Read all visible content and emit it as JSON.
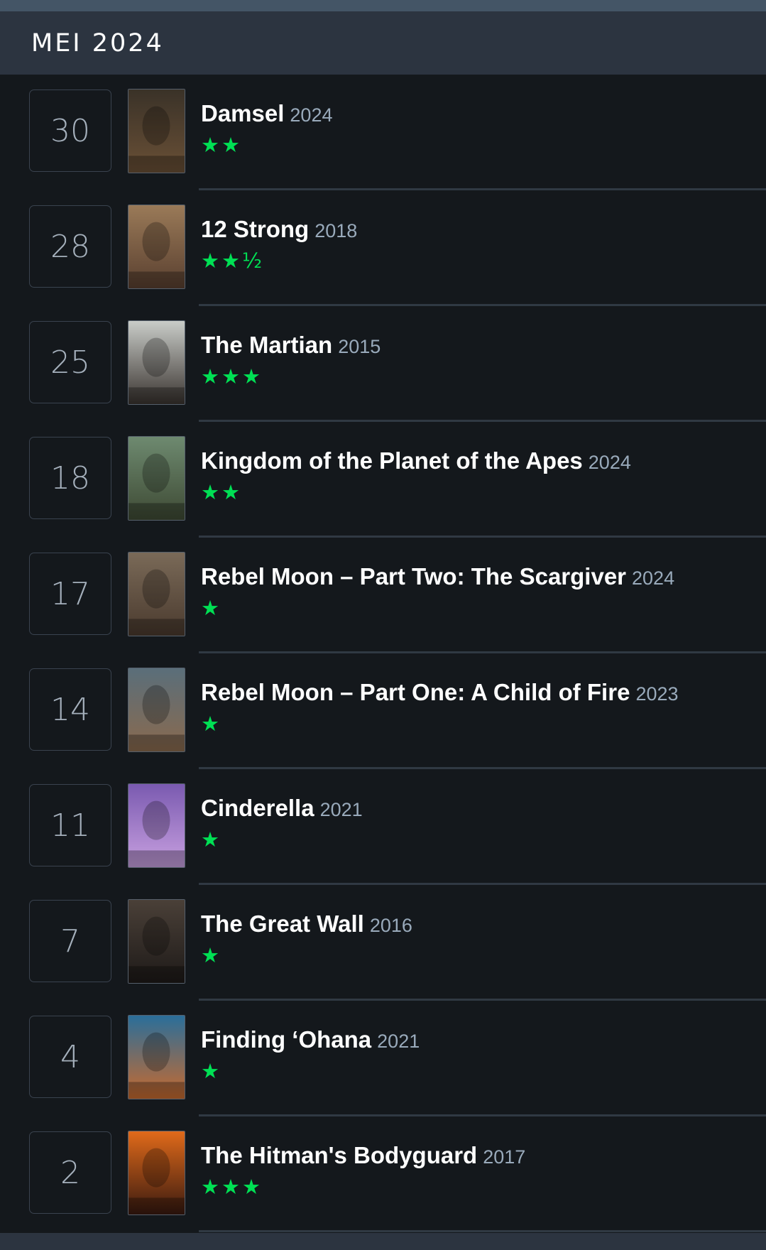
{
  "header": {
    "month": "MEI 2024"
  },
  "entries": [
    {
      "day": "30",
      "title": "Damsel",
      "year": "2024",
      "rating": "★★",
      "poster_colors": [
        "#3a3228",
        "#6a5036"
      ]
    },
    {
      "day": "28",
      "title": "12 Strong",
      "year": "2018",
      "rating": "★★½",
      "poster_colors": [
        "#9a7a58",
        "#5a4030"
      ]
    },
    {
      "day": "25",
      "title": "The Martian",
      "year": "2015",
      "rating": "★★★",
      "poster_colors": [
        "#c9ccc8",
        "#3a3430"
      ]
    },
    {
      "day": "18",
      "title": "Kingdom of the Planet of the Apes",
      "year": "2024",
      "rating": "★★",
      "poster_colors": [
        "#6e8a70",
        "#3e4a34"
      ]
    },
    {
      "day": "17",
      "title": "Rebel Moon – Part Two: The Scargiver",
      "year": "2024",
      "rating": "★",
      "poster_colors": [
        "#7a6a58",
        "#4a3a2e"
      ]
    },
    {
      "day": "14",
      "title": "Rebel Moon – Part One: A Child of Fire",
      "year": "2023",
      "rating": "★",
      "poster_colors": [
        "#5a6e7a",
        "#8a6a4e"
      ]
    },
    {
      "day": "11",
      "title": "Cinderella",
      "year": "2021",
      "rating": "★",
      "poster_colors": [
        "#7a5ab0",
        "#c8a0e0"
      ]
    },
    {
      "day": "7",
      "title": "The Great Wall",
      "year": "2016",
      "rating": "★",
      "poster_colors": [
        "#4a4038",
        "#1e1a18"
      ]
    },
    {
      "day": "4",
      "title": "Finding ‘Ohana",
      "year": "2021",
      "rating": "★",
      "poster_colors": [
        "#2a6e9a",
        "#c86a2e"
      ]
    },
    {
      "day": "2",
      "title": "The Hitman's Bodyguard",
      "year": "2017",
      "rating": "★★★",
      "poster_colors": [
        "#e06a1a",
        "#3a1a10"
      ]
    }
  ]
}
